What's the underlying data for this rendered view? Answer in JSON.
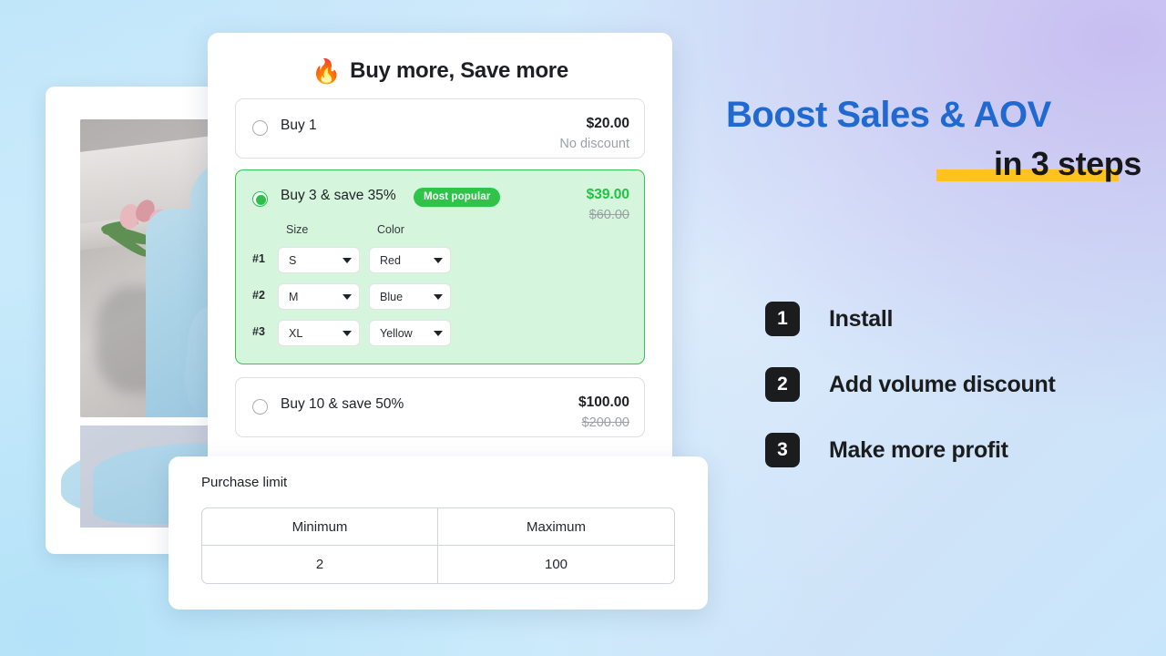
{
  "offer_card": {
    "title": "Buy more, Save more",
    "title_icon": "fire-emoji",
    "fire": "🔥",
    "options": [
      {
        "label": "Buy 1",
        "price": "$20.00",
        "subprice": "No discount",
        "selected": false,
        "badge": null
      },
      {
        "label": "Buy 3 & save 35%",
        "badge": "Most popular",
        "price": "$39.00",
        "subprice": "$60.00",
        "selected": true,
        "variant_headers": {
          "size": "Size",
          "color": "Color"
        },
        "variants": [
          {
            "num": "#1",
            "size": "S",
            "color": "Red"
          },
          {
            "num": "#2",
            "size": "M",
            "color": "Blue"
          },
          {
            "num": "#3",
            "size": "XL",
            "color": "Yellow"
          }
        ]
      },
      {
        "label": "Buy 10 & save 50%",
        "price": "$100.00",
        "subprice": "$200.00",
        "selected": false,
        "badge": null
      }
    ]
  },
  "purchase_limit": {
    "title": "Purchase limit",
    "columns": [
      "Minimum",
      "Maximum"
    ],
    "values": [
      "2",
      "100"
    ]
  },
  "promo": {
    "headline_line1": "Boost Sales  &  AOV",
    "headline_line2": "in 3 steps",
    "steps": [
      {
        "num": "1",
        "label": "Install"
      },
      {
        "num": "2",
        "label": "Add volume discount"
      },
      {
        "num": "3",
        "label": "Make more profit"
      }
    ]
  },
  "colors": {
    "headline_blue": "#1f69d0",
    "highlight_yellow": "#ffc21f",
    "badge_green": "#2ec449",
    "price_green": "#20c342",
    "selected_bg": "#d6f5dd",
    "selected_border": "#33c451",
    "step_badge": "#1b1c1e"
  }
}
